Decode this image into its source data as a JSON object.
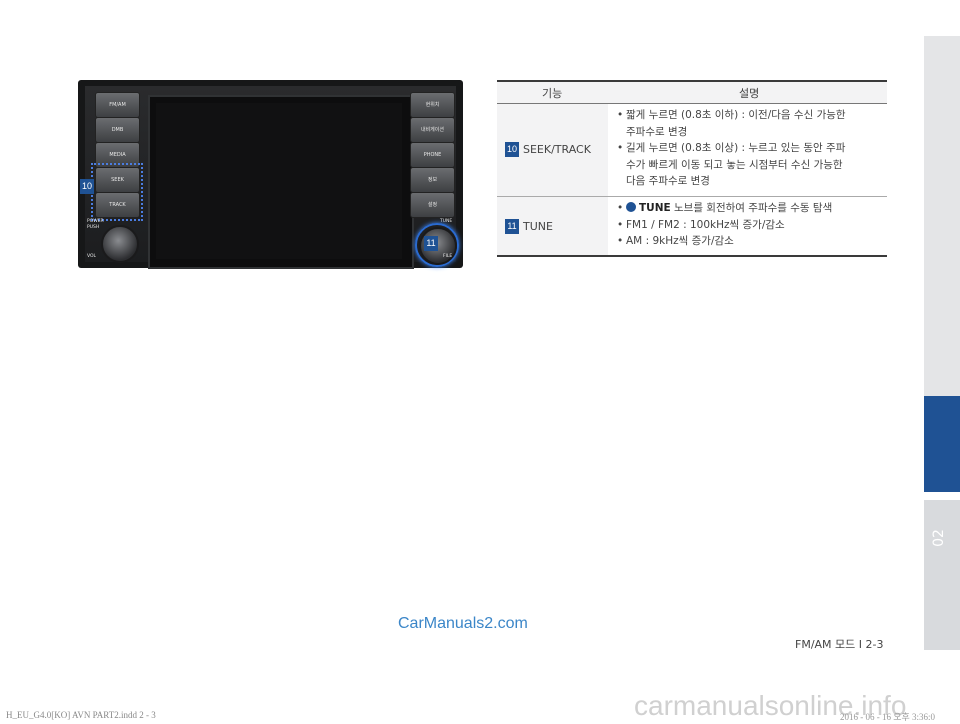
{
  "side_tab": {
    "chapter": "02"
  },
  "head_unit": {
    "left_buttons": [
      "FM/AM",
      "DMB",
      "MEDIA",
      "SEEK",
      "TRACK"
    ],
    "right_buttons": [
      "현위치",
      "내비게이션",
      "PHONE",
      "정보",
      "설정"
    ],
    "power_label": "POWER",
    "push_label": "PUSH",
    "vol_label": "VOL",
    "tune_label": "TUNE",
    "file_label": "FILE",
    "badge_seek": "10",
    "badge_tune": "11"
  },
  "table": {
    "header_feature": "기능",
    "header_desc": "설명",
    "rows": [
      {
        "badge": "10",
        "feature": "SEEK/TRACK",
        "items": [
          [
            "짧게 누르면 (0.8초 이하) : 이전/다음 수신 가능한",
            "주파수로 변경"
          ],
          [
            "길게 누르면 (0.8초 이상) : 누르고 있는 동안 주파",
            "수가 빠르게 이동 되고 놓는 시점부터 수신 가능한",
            "다음 주파수로 변경"
          ]
        ]
      },
      {
        "badge": "11",
        "feature": "TUNE",
        "tune_bold": "TUNE",
        "tune_rest": " 노브를 회전하여 주파수를 수동 탐색",
        "item2": "FM1 / FM2 : 100kHz씩 증가/감소",
        "item3": "AM : 9kHz씩 증가/감소"
      }
    ]
  },
  "footer": {
    "watermark": "CarManuals2.com",
    "page": "FM/AM 모드 I 2-3",
    "print_file": "H_EU_G4.0[KO] AVN PART2.indd   2 - 3",
    "print_date": "2016 - 06 - 16   오후 3:36:0",
    "site": "carmanualsonline.info"
  }
}
